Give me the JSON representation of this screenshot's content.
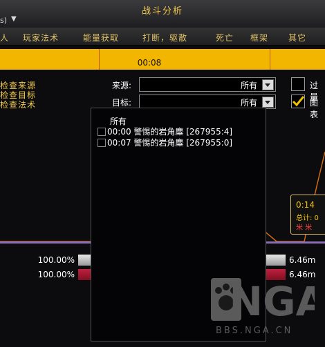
{
  "window": {
    "title": "战斗分析",
    "mode_fragment": "s)",
    "mode_caret": "▼"
  },
  "tabs": [
    {
      "label": "人",
      "id": "tab-people"
    },
    {
      "label": "玩家法术",
      "id": "tab-player-spells"
    },
    {
      "label": "能量获取",
      "id": "tab-energy"
    },
    {
      "label": "打断，驱散",
      "id": "tab-interrupt"
    },
    {
      "label": "死亡",
      "id": "tab-death"
    },
    {
      "label": "框架",
      "id": "tab-frame"
    },
    {
      "label": "其它",
      "id": "tab-other"
    }
  ],
  "timeline": {
    "label": "00:08"
  },
  "left_list": [
    "检查来源",
    "检查目标",
    "检查法术"
  ],
  "filters": {
    "source_label": "来源:",
    "source_value": "所有",
    "target_label": "目标:",
    "target_value": "所有"
  },
  "right_options": {
    "first_label": "过量",
    "second_label": "图表"
  },
  "popup": {
    "options": [
      {
        "label": "所有",
        "checkbox": false
      },
      {
        "label": "00:00 警惕的岩角麋 [267955:4]",
        "checkbox": true
      },
      {
        "label": "00:07 警惕的岩角麋 [267955:0]",
        "checkbox": true
      }
    ]
  },
  "bars": [
    {
      "percent": "100.00%",
      "time": "6.46m",
      "color": "#c9c9c9"
    },
    {
      "percent": "100.00%",
      "time": "6.46m",
      "color": "#a01830"
    }
  ],
  "tooltip": {
    "time": "0:14",
    "total_fragment": "总计: 0",
    "names_fragment": "米 米"
  },
  "colors": {
    "gold": "#f3b600",
    "label_gold": "#f2c94c",
    "graph_line": "#d06a10"
  },
  "watermark": {
    "logo_text": "NGA",
    "url": "BBS.NGA.CN"
  }
}
